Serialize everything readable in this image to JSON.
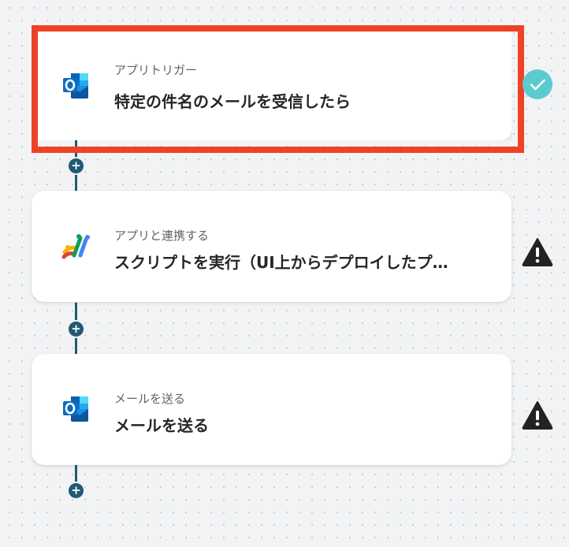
{
  "flow": {
    "steps": [
      {
        "subtitle": "アプリトリガー",
        "title": "特定の件名のメールを受信したら",
        "icon": "outlook-icon",
        "status": "complete-check-icon",
        "selected": true
      },
      {
        "subtitle": "アプリと連携する",
        "title": "スクリプトを実行（UI上からデプロイしたプ…",
        "icon": "google-apps-script-icon",
        "status": "warning-icon",
        "selected": false
      },
      {
        "subtitle": "メールを送る",
        "title": "メールを送る",
        "icon": "outlook-icon",
        "status": "warning-icon",
        "selected": false
      }
    ],
    "add_step_symbol": "+"
  },
  "colors": {
    "selection_outline": "#ee4227",
    "connector": "#1f5a74",
    "check_badge": "#5ccbd0",
    "warning": "#222222",
    "outlook_blue": "#0f6cbd"
  }
}
